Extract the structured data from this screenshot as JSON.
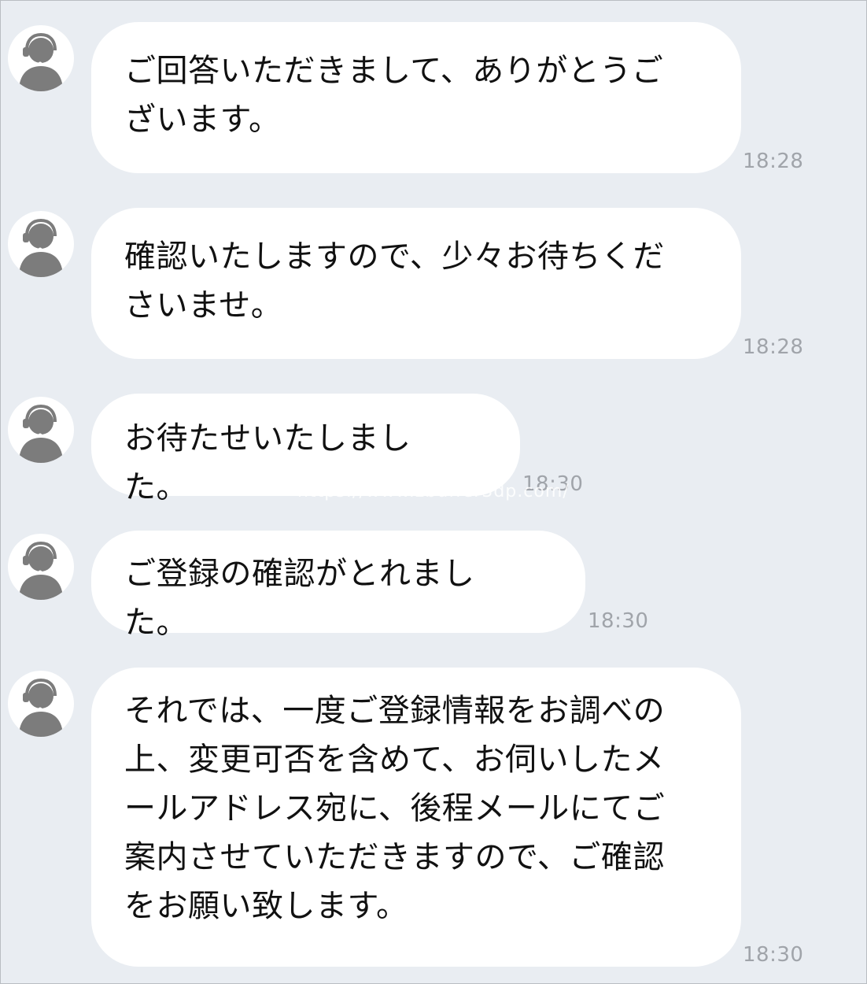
{
  "messages": [
    {
      "text": "ご回答いただきまして、ありがとうご\nざいます。",
      "time": "18:28"
    },
    {
      "text": "確認いたしますので、少々お待ちくだ\nさいませ。",
      "time": "18:28"
    },
    {
      "text": "お待たせいたしました。",
      "time": "18:30"
    },
    {
      "text": "ご登録の確認がとれました。",
      "time": "18:30"
    },
    {
      "text": "それでは、一度ご登録情報をお調べの\n上、変更可否を含めて、お伺いしたメ\nールアドレス宛に、後程メールにてご\n案内させていただきますので、ご確認\nをお願い致します。",
      "time": "18:30"
    }
  ],
  "watermark": "https://www.zbuffer3dp.com/",
  "avatar_icon": "operator-headset-icon",
  "colors": {
    "background": "#e9edf2",
    "bubble": "#ffffff",
    "avatar_figure": "#7c7c7c",
    "time": "#a0a4aa"
  }
}
